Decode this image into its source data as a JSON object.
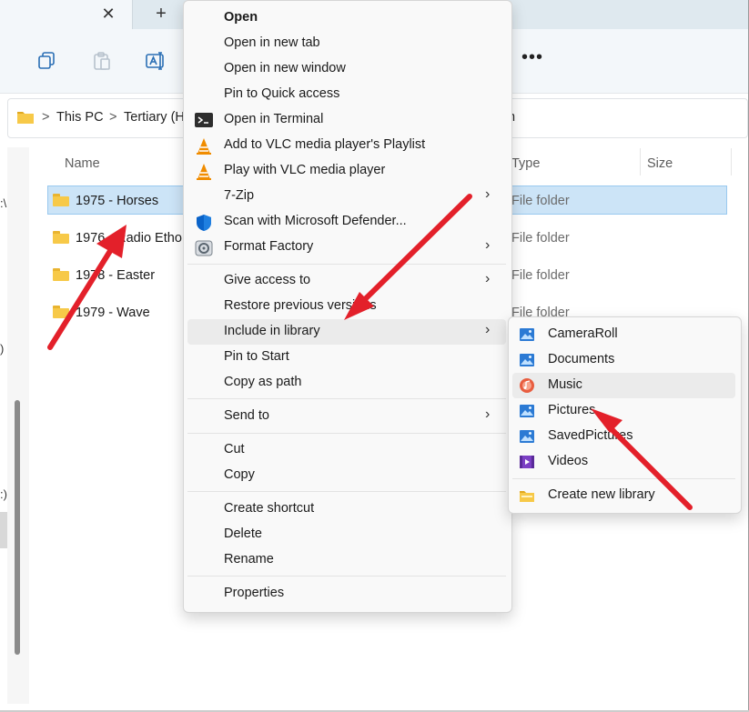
{
  "window": {
    "tab_close_glyph": "✕",
    "tab_add_glyph": "+",
    "toolbar_more_glyph": "•••"
  },
  "address": {
    "crumbs": [
      "This PC",
      "Tertiary (H",
      "n"
    ],
    "separator": ">"
  },
  "nav_fragments": [
    ":\\",
    ")",
    ":)"
  ],
  "columns": {
    "name": "Name",
    "type": "Type",
    "size": "Size"
  },
  "rows": [
    {
      "name": "1975 - Horses",
      "type": "File folder",
      "selected": true
    },
    {
      "name": "1976 - Radio Etho",
      "type": "File folder",
      "selected": false
    },
    {
      "name": "1978 - Easter",
      "type": "File folder",
      "selected": false
    },
    {
      "name": "1979 - Wave",
      "type": "File folder",
      "selected": false
    }
  ],
  "context_menu": {
    "items": [
      {
        "label": "Open",
        "bold": true
      },
      {
        "label": "Open in new tab"
      },
      {
        "label": "Open in new window"
      },
      {
        "label": "Pin to Quick access"
      },
      {
        "label": "Open in Terminal",
        "icon": "terminal-icon"
      },
      {
        "label": "Add to VLC media player's Playlist",
        "icon": "vlc-icon"
      },
      {
        "label": "Play with VLC media player",
        "icon": "vlc-icon"
      },
      {
        "label": "7-Zip",
        "submenu": true
      },
      {
        "label": "Scan with Microsoft Defender...",
        "icon": "defender-shield-icon"
      },
      {
        "label": "Format Factory",
        "icon": "format-factory-icon",
        "submenu": true
      },
      {
        "label": "Give access to",
        "submenu": true
      },
      {
        "label": "Restore previous versions"
      },
      {
        "label": "Include in library",
        "submenu": true,
        "highlighted": true
      },
      {
        "label": "Pin to Start"
      },
      {
        "label": "Copy as path"
      },
      {
        "label": "Send to",
        "submenu": true
      },
      {
        "label": "Cut"
      },
      {
        "label": "Copy"
      },
      {
        "label": "Create shortcut"
      },
      {
        "label": "Delete"
      },
      {
        "label": "Rename"
      },
      {
        "label": "Properties"
      }
    ],
    "submenu_glyph": "›"
  },
  "library_submenu": {
    "items": [
      {
        "label": "CameraRoll",
        "icon": "picture-library-icon"
      },
      {
        "label": "Documents",
        "icon": "picture-library-icon"
      },
      {
        "label": "Music",
        "icon": "music-library-icon",
        "highlighted": true
      },
      {
        "label": "Pictures",
        "icon": "picture-library-icon"
      },
      {
        "label": "SavedPictures",
        "icon": "picture-library-icon"
      },
      {
        "label": "Videos",
        "icon": "video-library-icon"
      },
      {
        "label": "Create new library",
        "icon": "new-library-folder-icon"
      }
    ]
  },
  "colors": {
    "selection": "#cce4f7",
    "annotation_arrow": "#e3202a",
    "folder": "#f7c948"
  }
}
